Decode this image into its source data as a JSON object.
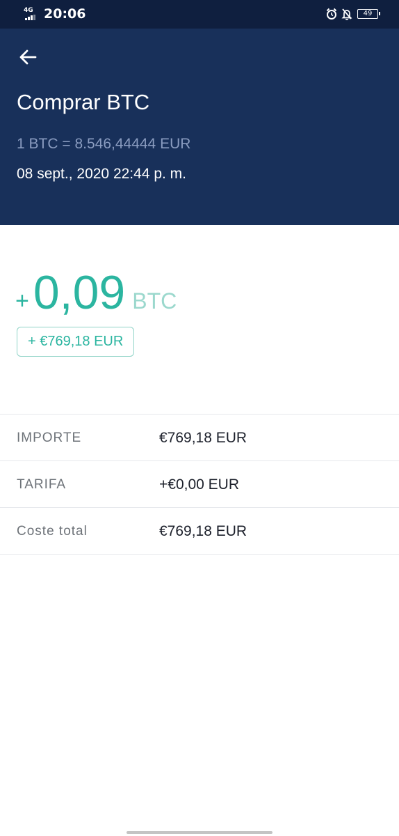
{
  "status_bar": {
    "network": "4G",
    "time": "20:06",
    "battery": "49",
    "icons": [
      "alarm-icon",
      "notifications-off-icon",
      "battery-icon"
    ]
  },
  "header": {
    "back_icon": "arrow-left-icon",
    "title": "Comprar BTC",
    "rate": "1 BTC = 8.546,44444 EUR",
    "datetime": "08 sept., 2020 22:44 p. m."
  },
  "summary": {
    "sign": "+",
    "amount": "0,09",
    "unit": "BTC",
    "fiat_badge": "+ €769,18 EUR"
  },
  "details": [
    {
      "label": "IMPORTE",
      "value": "€769,18 EUR"
    },
    {
      "label": "TARIFA",
      "value": "+€0,00 EUR"
    },
    {
      "label": "Coste total",
      "value": "€769,18 EUR"
    }
  ],
  "colors": {
    "status_bar_bg": "#0f1f3f",
    "header_bg": "#18305a",
    "accent_green": "#2bb5a0",
    "muted_green": "#9bd8cd"
  }
}
